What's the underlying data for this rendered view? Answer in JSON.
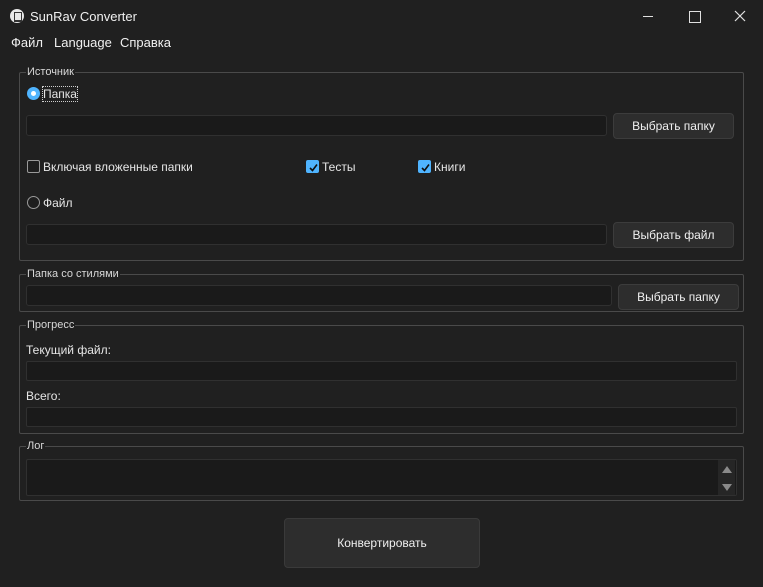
{
  "window": {
    "title": "SunRav Converter"
  },
  "menu": {
    "file": "Файл",
    "language": "Language",
    "help": "Справка"
  },
  "source": {
    "title": "Источник",
    "folder_radio": "Папка",
    "folder_path": "",
    "browse_folder": "Выбрать папку",
    "include_subfolders": "Включая вложенные папки",
    "tests": "Тесты",
    "books": "Книги",
    "file_radio": "Файл",
    "file_path": "",
    "browse_file": "Выбрать файл"
  },
  "styles": {
    "title": "Папка со стилями",
    "path": "",
    "browse": "Выбрать папку"
  },
  "progress": {
    "title": "Прогресс",
    "current_label": "Текущий файл:",
    "total_label": "Всего:",
    "current_value": 0,
    "total_value": 0
  },
  "log": {
    "title": "Лог",
    "content": ""
  },
  "convert_button": "Конвертировать",
  "colors": {
    "background": "#202020",
    "accent": "#4fb4ff",
    "field": "#1a1a1a",
    "button": "#2d2d2d"
  }
}
